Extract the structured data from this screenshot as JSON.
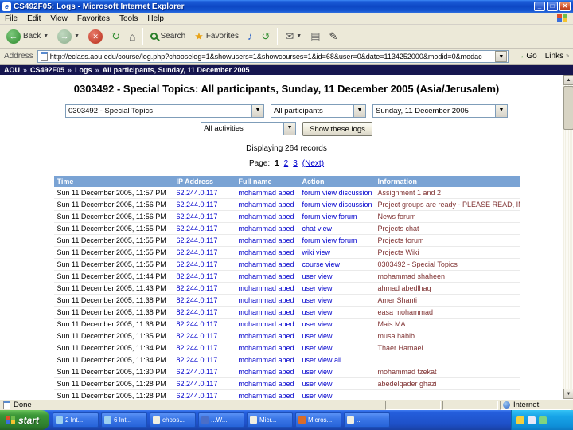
{
  "window": {
    "title": "CS492F05: Logs - Microsoft Internet Explorer",
    "menu_items": [
      "File",
      "Edit",
      "View",
      "Favorites",
      "Tools",
      "Help"
    ],
    "toolbar": {
      "back_label": "Back",
      "search_label": "Search",
      "favorites_label": "Favorites"
    },
    "address": {
      "label": "Address",
      "url": "http://eclass.aou.edu/course/log.php?chooselog=1&showusers=1&showcourses=1&id=68&user=0&date=1134252000&modid=0&modac",
      "go_label": "Go",
      "links_label": "Links"
    },
    "status": {
      "left": "Done",
      "zone": "Internet"
    }
  },
  "page": {
    "breadcrumb": [
      "AOU",
      "CS492F05",
      "Logs",
      "All participants, Sunday, 11 December 2005"
    ],
    "heading": "0303492 - Special Topics: All participants, Sunday, 11 December 2005 (Asia/Jerusalem)",
    "filters": {
      "course": "0303492 - Special Topics",
      "participants": "All participants",
      "date": "Sunday, 11 December 2005",
      "activities": "All activities",
      "show_button": "Show these logs"
    },
    "records_text": "Displaying 264 records",
    "pagination": {
      "label": "Page:",
      "pages": [
        "1",
        "2",
        "3",
        "(Next)"
      ]
    },
    "table": {
      "headers": [
        "Time",
        "IP Address",
        "Full name",
        "Action",
        "Information"
      ],
      "rows": [
        {
          "time": "Sun 11 December 2005, 11:57 PM",
          "ip": "62.244.0.117",
          "name": "mohammad abed",
          "action": "forum view discussion",
          "info": "Assignment 1 and 2"
        },
        {
          "time": "Sun 11 December 2005, 11:56 PM",
          "ip": "62.244.0.117",
          "name": "mohammad abed",
          "action": "forum view discussion",
          "info": "Project groups are ready - PLEASE READ, IMPORTANT, ETC"
        },
        {
          "time": "Sun 11 December 2005, 11:56 PM",
          "ip": "62.244.0.117",
          "name": "mohammad abed",
          "action": "forum view forum",
          "info": "News forum"
        },
        {
          "time": "Sun 11 December 2005, 11:55 PM",
          "ip": "62.244.0.117",
          "name": "mohammad abed",
          "action": "chat view",
          "info": "Projects chat"
        },
        {
          "time": "Sun 11 December 2005, 11:55 PM",
          "ip": "62.244.0.117",
          "name": "mohammad abed",
          "action": "forum view forum",
          "info": "Projects forum"
        },
        {
          "time": "Sun 11 December 2005, 11:55 PM",
          "ip": "62.244.0.117",
          "name": "mohammad abed",
          "action": "wiki view",
          "info": "Projects Wiki"
        },
        {
          "time": "Sun 11 December 2005, 11:55 PM",
          "ip": "62.244.0.117",
          "name": "mohammad abed",
          "action": "course view",
          "info": "0303492 - Special Topics"
        },
        {
          "time": "Sun 11 December 2005, 11:44 PM",
          "ip": "82.244.0.117",
          "name": "mohammad abed",
          "action": "user view",
          "info": "mohammad shaheen"
        },
        {
          "time": "Sun 11 December 2005, 11:43 PM",
          "ip": "82.244.0.117",
          "name": "mohammad abed",
          "action": "user view",
          "info": "ahmad abedlhaq"
        },
        {
          "time": "Sun 11 December 2005, 11:38 PM",
          "ip": "82.244.0.117",
          "name": "mohammad abed",
          "action": "user view",
          "info": "Amer Shanti"
        },
        {
          "time": "Sun 11 December 2005, 11:38 PM",
          "ip": "82.244.0.117",
          "name": "mohammad abed",
          "action": "user view",
          "info": "easa mohammad"
        },
        {
          "time": "Sun 11 December 2005, 11:38 PM",
          "ip": "82.244.0.117",
          "name": "mohammad abed",
          "action": "user view",
          "info": "Mais MA"
        },
        {
          "time": "Sun 11 December 2005, 11:35 PM",
          "ip": "82.244.0.117",
          "name": "mohammad abed",
          "action": "user view",
          "info": "musa habib"
        },
        {
          "time": "Sun 11 December 2005, 11:34 PM",
          "ip": "82.244.0.117",
          "name": "mohammad abed",
          "action": "user view",
          "info": "Thaer Hamael"
        },
        {
          "time": "Sun 11 December 2005, 11:34 PM",
          "ip": "82.244.0.117",
          "name": "mohammad abed",
          "action": "user view all",
          "info": ""
        },
        {
          "time": "Sun 11 December 2005, 11:30 PM",
          "ip": "62.244.0.117",
          "name": "mohammad abed",
          "action": "user view",
          "info": "mohammad tzekat"
        },
        {
          "time": "Sun 11 December 2005, 11:28 PM",
          "ip": "62.244.0.117",
          "name": "mohammad abed",
          "action": "user view",
          "info": "abedelqader ghazi"
        },
        {
          "time": "Sun 11 December 2005, 11:28 PM",
          "ip": "62.244.0.117",
          "name": "mohammad abed",
          "action": "user view",
          "info": ""
        }
      ]
    }
  },
  "taskbar": {
    "start_label": "start",
    "items": [
      {
        "label": "2 Int...",
        "icon": "ie"
      },
      {
        "label": "6 Int...",
        "icon": "ie"
      },
      {
        "label": "choos...",
        "icon": "doc"
      },
      {
        "label": "...W...",
        "icon": "word"
      },
      {
        "label": "Micr...",
        "icon": "doc"
      },
      {
        "label": "Micros...",
        "icon": "ppt"
      },
      {
        "label": "...",
        "icon": "doc"
      }
    ]
  }
}
